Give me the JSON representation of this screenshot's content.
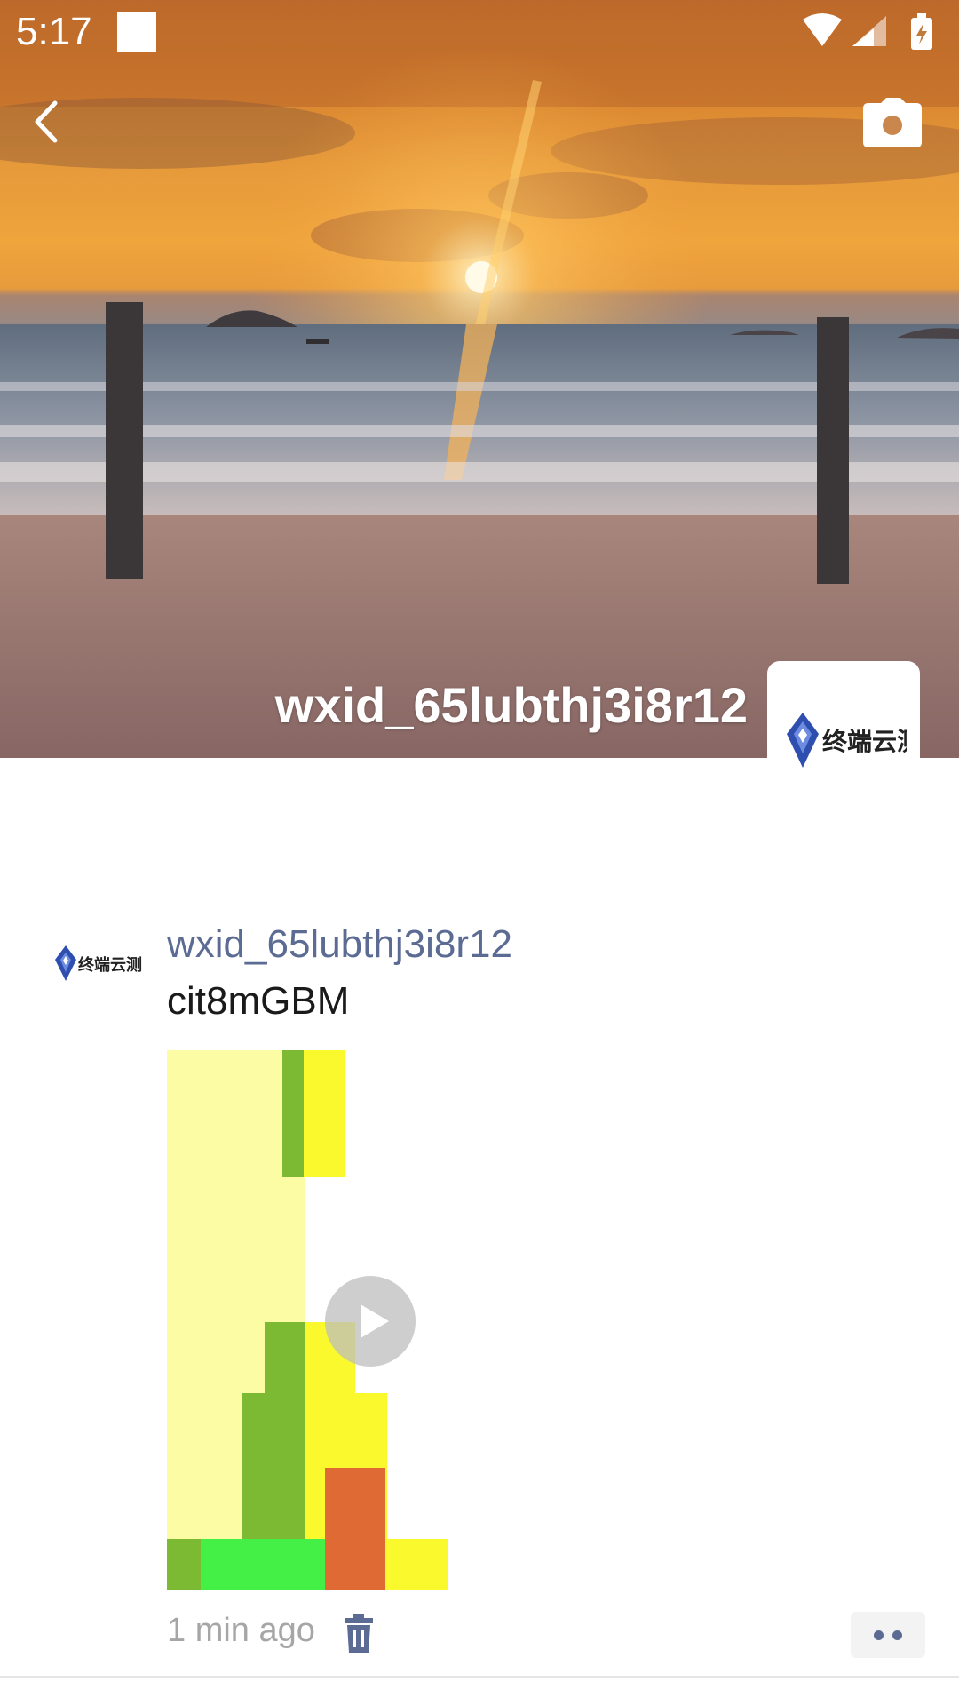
{
  "status_bar": {
    "time": "5:17",
    "icons": [
      "notification-square-icon",
      "wifi-icon",
      "cellular-signal-icon",
      "battery-charging-icon"
    ]
  },
  "cover": {
    "profile_name": "wxid_65lubthj3i8r12",
    "logo_text": "终端云测"
  },
  "nav": {
    "back_icon": "chevron-left-icon",
    "camera_icon": "camera-icon"
  },
  "post": {
    "author": "wxid_65lubthj3i8r12",
    "text": "cit8mGBM",
    "media_type": "video",
    "timestamp": "1 min ago",
    "avatar_logo_text": "终端云测",
    "icons": [
      "play-icon",
      "trash-icon",
      "more-dots-icon"
    ]
  },
  "colors": {
    "author_link": "#5b6b93",
    "timestamp": "#a6a6a6"
  }
}
